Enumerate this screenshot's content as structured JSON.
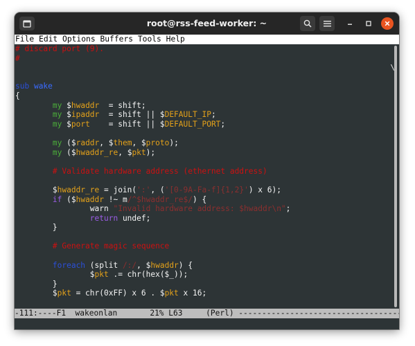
{
  "window": {
    "title": "root@rss-feed-worker: ~"
  },
  "menubar": {
    "items": [
      "File",
      "Edit",
      "Options",
      "Buffers",
      "Tools",
      "Help"
    ]
  },
  "editor": {
    "lines": [
      [
        {
          "t": "# discard port (9).",
          "c": "com"
        }
      ],
      [
        {
          "t": "#",
          "c": "com"
        }
      ],
      [],
      [],
      [
        {
          "t": "sub ",
          "c": "kw2"
        },
        {
          "t": "wake",
          "c": "sub"
        }
      ],
      [
        {
          "t": "{"
        }
      ],
      [
        {
          "t": "        "
        },
        {
          "t": "my ",
          "c": "my"
        },
        {
          "t": "$"
        },
        {
          "t": "hwaddr",
          "c": "var"
        },
        {
          "t": "  = shift;"
        }
      ],
      [
        {
          "t": "        "
        },
        {
          "t": "my ",
          "c": "my"
        },
        {
          "t": "$"
        },
        {
          "t": "ipaddr",
          "c": "var"
        },
        {
          "t": "  = shift || $"
        },
        {
          "t": "DEFAULT_IP",
          "c": "var"
        },
        {
          "t": ";"
        }
      ],
      [
        {
          "t": "        "
        },
        {
          "t": "my ",
          "c": "my"
        },
        {
          "t": "$"
        },
        {
          "t": "port",
          "c": "var"
        },
        {
          "t": "    = shift || $"
        },
        {
          "t": "DEFAULT_PORT",
          "c": "var"
        },
        {
          "t": ";"
        }
      ],
      [],
      [
        {
          "t": "        "
        },
        {
          "t": "my ",
          "c": "my"
        },
        {
          "t": "($"
        },
        {
          "t": "raddr",
          "c": "var"
        },
        {
          "t": ", $"
        },
        {
          "t": "them",
          "c": "var"
        },
        {
          "t": ", $"
        },
        {
          "t": "proto",
          "c": "var"
        },
        {
          "t": ");"
        }
      ],
      [
        {
          "t": "        "
        },
        {
          "t": "my ",
          "c": "my"
        },
        {
          "t": "($"
        },
        {
          "t": "hwaddr_re",
          "c": "var"
        },
        {
          "t": ", $"
        },
        {
          "t": "pkt",
          "c": "var"
        },
        {
          "t": ");"
        }
      ],
      [],
      [
        {
          "t": "        "
        },
        {
          "t": "# Validate hardware address (ethernet address)",
          "c": "com"
        }
      ],
      [],
      [
        {
          "t": "        $"
        },
        {
          "t": "hwaddr_re",
          "c": "var"
        },
        {
          "t": " = join("
        },
        {
          "t": "':'",
          "c": "str"
        },
        {
          "t": ", ("
        },
        {
          "t": "'[0-9A-Fa-f]{1,2}'",
          "c": "str"
        },
        {
          "t": ") x 6);"
        }
      ],
      [
        {
          "t": "        "
        },
        {
          "t": "if ",
          "c": "kw"
        },
        {
          "t": "($"
        },
        {
          "t": "hwaddr",
          "c": "var"
        },
        {
          "t": " !~ m"
        },
        {
          "t": "/^$hwaddr_re$/",
          "c": "str"
        },
        {
          "t": ") {"
        }
      ],
      [
        {
          "t": "                warn "
        },
        {
          "t": "\"Invalid hardware address: $hwaddr\\n\"",
          "c": "str"
        },
        {
          "t": ";"
        }
      ],
      [
        {
          "t": "                "
        },
        {
          "t": "return ",
          "c": "kw"
        },
        {
          "t": "undef;"
        }
      ],
      [
        {
          "t": "        }"
        }
      ],
      [],
      [
        {
          "t": "        "
        },
        {
          "t": "# Generate magic sequence",
          "c": "com"
        }
      ],
      [],
      [
        {
          "t": "        "
        },
        {
          "t": "foreach ",
          "c": "kw2"
        },
        {
          "t": "(split "
        },
        {
          "t": "/:/",
          "c": "str"
        },
        {
          "t": ", $"
        },
        {
          "t": "hwaddr",
          "c": "var"
        },
        {
          "t": ") {"
        }
      ],
      [
        {
          "t": "                $"
        },
        {
          "t": "pkt",
          "c": "var"
        },
        {
          "t": " .= chr(hex($_));"
        }
      ],
      [
        {
          "t": "        }"
        }
      ],
      [
        {
          "t": "        $"
        },
        {
          "t": "pkt",
          "c": "var"
        },
        {
          "t": " = chr(0xFF) x 6 . $"
        },
        {
          "t": "pkt",
          "c": "var"
        },
        {
          "t": " x 16;"
        }
      ]
    ],
    "continuation_mark": "\\"
  },
  "modeline": {
    "text": "-111:----F1  wakeonlan       21% L63     (Perl) -----------------------------------"
  },
  "colors": {
    "background": "#2d3436",
    "comment": "#cc1111",
    "keyword": "#9b5de5",
    "variable": "#e3a11a",
    "string": "#8b2f2f",
    "declaration": "#4caf3a"
  }
}
